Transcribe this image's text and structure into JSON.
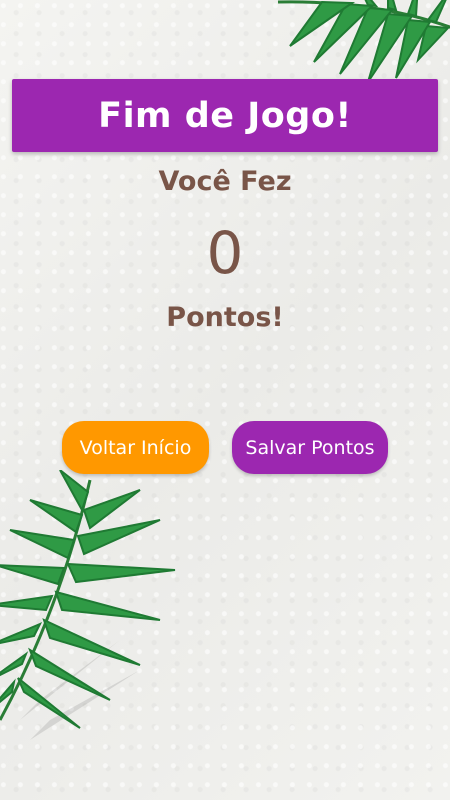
{
  "title": "Fim de Jogo!",
  "score": {
    "prefix": "Você Fez",
    "value": "0",
    "suffix": "Pontos!"
  },
  "buttons": {
    "home_label": "Voltar Início",
    "save_label": "Salvar Pontos"
  },
  "colors": {
    "purple": "#9c27b0",
    "orange": "#ff9800",
    "brown": "#795548",
    "leaf_green": "#2e8b3e"
  },
  "decor": {
    "top_leaf_icon": "palm-leaf-icon",
    "bottom_leaf_icon": "palm-leaf-icon"
  }
}
